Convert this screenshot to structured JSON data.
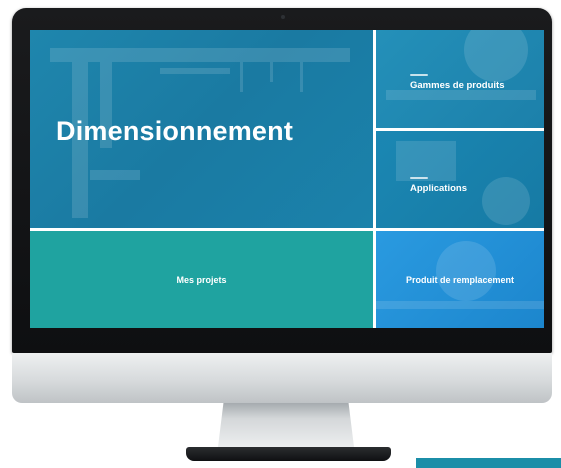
{
  "tiles": {
    "main": {
      "title": "Dimensionnement"
    },
    "product_ranges": {
      "label": "Gammes de produits"
    },
    "applications": {
      "label": "Applications"
    },
    "my_projects": {
      "label": "Mes projets"
    },
    "replacement": {
      "label": "Produit de remplacement"
    }
  },
  "colors": {
    "main_tile": "#1f86ad",
    "projects_tile": "#1fa3a0",
    "replacement_tile": "#2a9ae0",
    "bezel": "#111214",
    "stand_accent": "#1b8ea8"
  }
}
